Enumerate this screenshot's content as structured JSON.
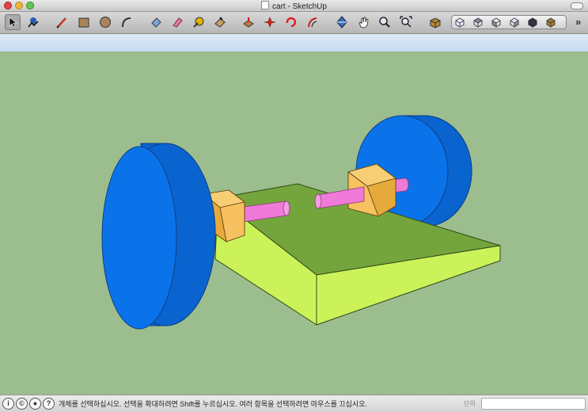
{
  "window": {
    "title": "cart - SketchUp"
  },
  "toolbar": {
    "tools": [
      "select-icon",
      "component-icon",
      "pencil-icon",
      "rectangle-icon",
      "circle-icon",
      "arc-icon",
      "eraser-icon",
      "paint-bucket-icon",
      "tape-measure-icon",
      "push-pull-icon",
      "move-icon",
      "rotate-icon",
      "follow-me-icon",
      "orbit-icon",
      "pan-icon",
      "zoom-icon",
      "zoom-extents-icon",
      "components-icon"
    ],
    "views": [
      "iso-view-icon",
      "top-view-icon",
      "front-view-icon",
      "right-view-icon",
      "back-view-icon",
      "left-view-icon"
    ],
    "overflow_label": "»"
  },
  "model": {
    "board_top_color": "#74a53d",
    "board_side_color": "#ccf25a",
    "wheel_color": "#0b73ea",
    "axle_color": "#f07ad8",
    "bearing_color": "#f6c15e"
  },
  "statusbar": {
    "message": "개체를 선택하십시오. 선택을 확대하려면 Shift를 누르십시오. 여러 항목을 선택하려면 마우스를 끄십시오.",
    "measure_label": "단위",
    "measure_value": ""
  }
}
